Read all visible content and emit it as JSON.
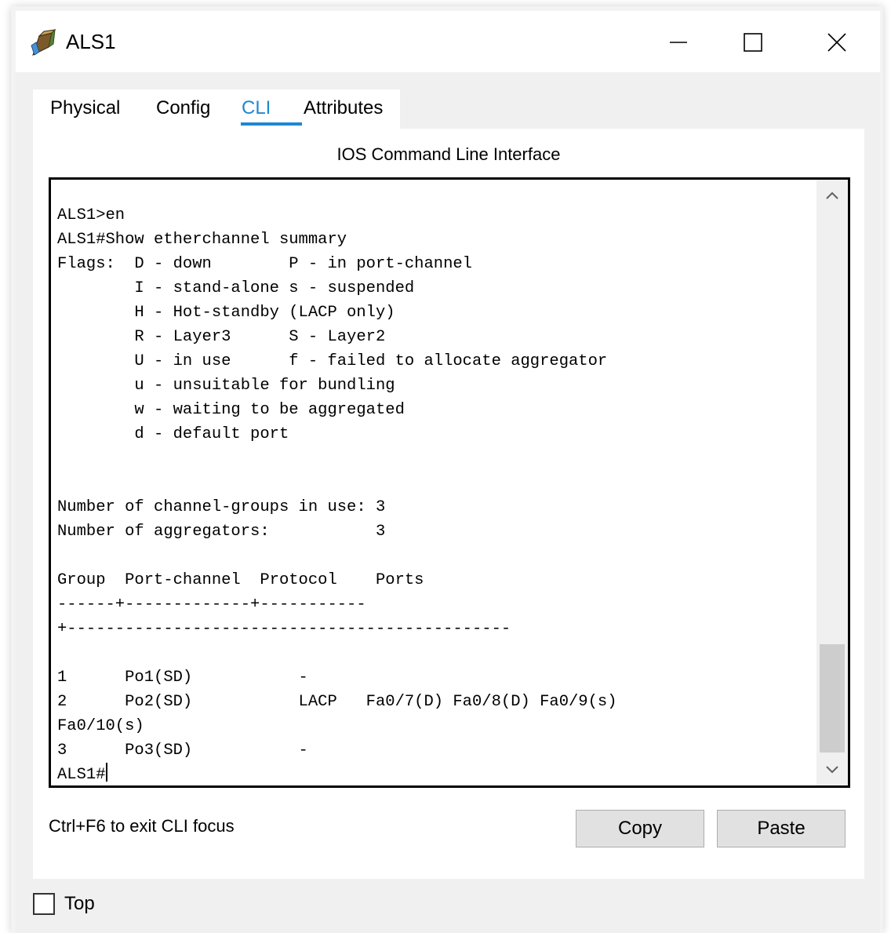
{
  "window": {
    "title": "ALS1",
    "icon": "packet-tracer-switch-icon"
  },
  "tabs": [
    {
      "label": "Physical",
      "active": false
    },
    {
      "label": "Config",
      "active": false
    },
    {
      "label": "CLI",
      "active": true
    },
    {
      "label": "Attributes",
      "active": false
    }
  ],
  "panel": {
    "heading": "IOS Command Line Interface"
  },
  "terminal": {
    "lines": [
      "ALS1>en",
      "ALS1#Show etherchannel summary",
      "Flags:  D - down        P - in port-channel",
      "        I - stand-alone s - suspended",
      "        H - Hot-standby (LACP only)",
      "        R - Layer3      S - Layer2",
      "        U - in use      f - failed to allocate aggregator",
      "        u - unsuitable for bundling",
      "        w - waiting to be aggregated",
      "        d - default port",
      "",
      "",
      "Number of channel-groups in use: 3",
      "Number of aggregators:           3",
      "",
      "Group  Port-channel  Protocol    Ports",
      "------+-------------+-----------",
      "+----------------------------------------------",
      "",
      "1      Po1(SD)           -",
      "2      Po2(SD)           LACP   Fa0/7(D) Fa0/8(D) Fa0/9(s)",
      "Fa0/10(s)",
      "3      Po3(SD)           -",
      "ALS1#"
    ]
  },
  "footer": {
    "hint": "Ctrl+F6 to exit CLI focus",
    "copy_label": "Copy",
    "paste_label": "Paste",
    "top_label": "Top",
    "top_checked": false
  },
  "colors": {
    "accent": "#1e88d2",
    "window_bg": "#f0f0f0",
    "button_bg": "#e1e1e1"
  }
}
